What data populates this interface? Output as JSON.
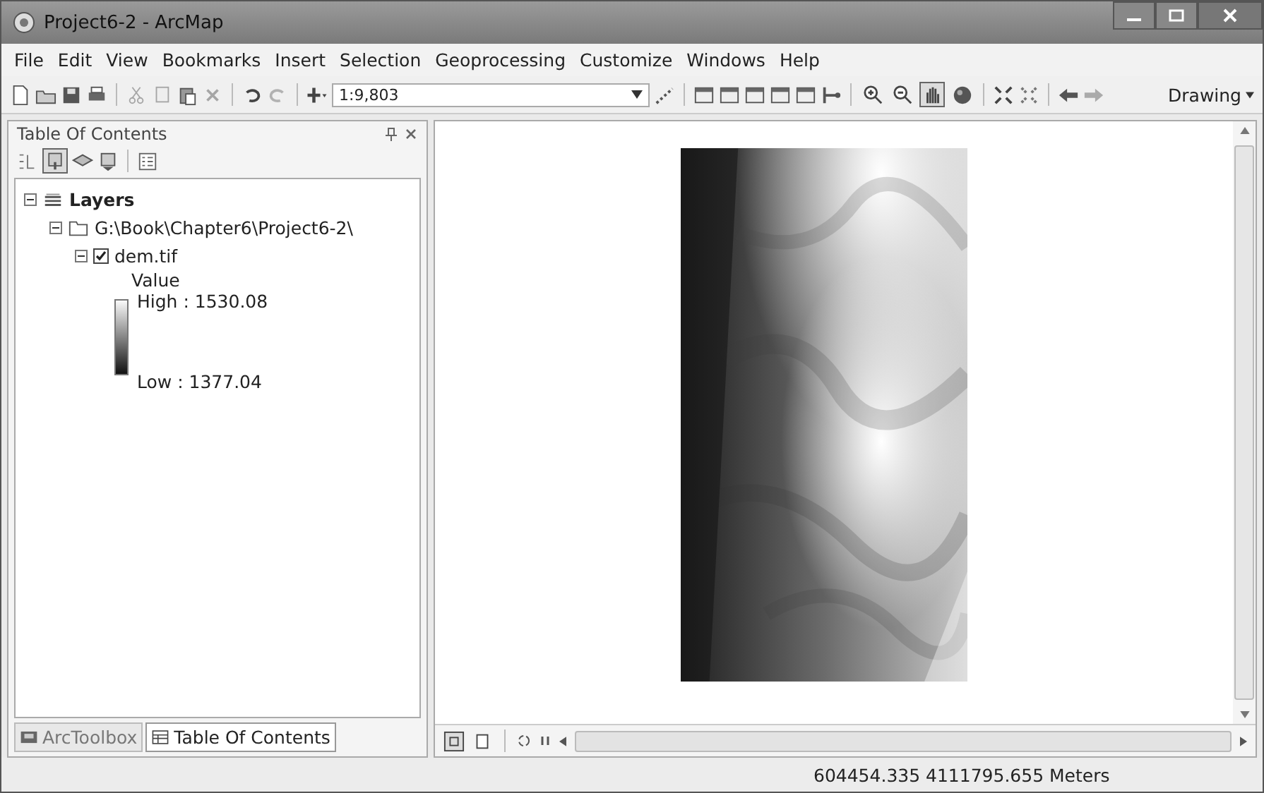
{
  "window": {
    "title": "Project6-2 - ArcMap"
  },
  "menu": [
    "File",
    "Edit",
    "View",
    "Bookmarks",
    "Insert",
    "Selection",
    "Geoprocessing",
    "Customize",
    "Windows",
    "Help"
  ],
  "toolbar": {
    "scale": "1:9,803",
    "drawing": "Drawing"
  },
  "map_tools": [
    {
      "kind": "zoom-in",
      "selected": false
    },
    {
      "kind": "zoom-out",
      "selected": false
    },
    {
      "kind": "pan",
      "selected": true
    },
    {
      "kind": "globe",
      "selected": false
    }
  ],
  "toc": {
    "title": "Table Of Contents",
    "tree": [
      {
        "label": "Layers",
        "expanded": true,
        "children": [
          {
            "label": "G:\\Book\\Chapter6\\Project6-2\\",
            "expanded": true,
            "children": [
              {
                "label": "dem.tif",
                "expanded": true,
                "checked": true,
                "legend": {
                  "field": "Value",
                  "high": "High : 1530.08",
                  "low": "Low : 1377.04"
                }
              }
            ]
          }
        ]
      }
    ]
  },
  "tabs": [
    {
      "label": "ArcToolbox",
      "selected": false
    },
    {
      "label": "Table Of Contents",
      "selected": true
    }
  ],
  "status_bar": {
    "coordinates": "604454.335  4111795.655 Meters"
  }
}
